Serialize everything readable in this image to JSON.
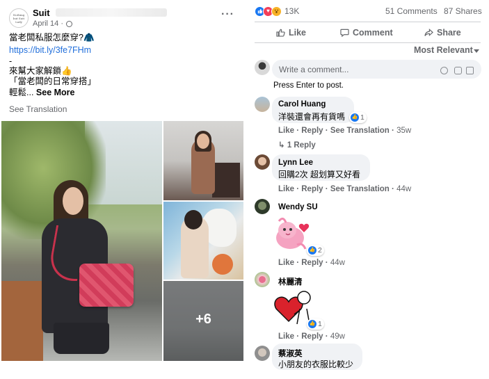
{
  "post": {
    "page_name": "Suit",
    "page_logo_text": "Nothing but Suit Lady",
    "date": "April 14 ·",
    "more": "···",
    "lines": [
      "當老闆私服怎麼穿?🧥",
      "https://bit.ly/3fe7FHm",
      "-",
      "來幫大家解鎖👍",
      "「當老闆的日常穿搭」",
      "輕鬆..."
    ],
    "see_more": "See More",
    "see_translation": "See Translation",
    "extra_photos": "+6"
  },
  "reactions": {
    "icons": [
      "like-icon",
      "love-icon",
      "wow-icon"
    ],
    "count": "13K",
    "comments": "51 Comments",
    "shares": "87 Shares"
  },
  "actions": {
    "like": "Like",
    "comment": "Comment",
    "share": "Share"
  },
  "sort": {
    "label": "Most Relevant"
  },
  "composer": {
    "placeholder": "Write a comment...",
    "hint": "Press Enter to post."
  },
  "comments": [
    {
      "name": "Carol Huang",
      "text": "洋裝還會再有貨嗎",
      "like": "Like",
      "reply": "Reply",
      "translate": "See Translation",
      "time": "35w",
      "reactions": "1",
      "replies": "1 Reply"
    },
    {
      "name": "Lynn Lee",
      "text": "回購2次 超划算又好看",
      "like": "Like",
      "reply": "Reply",
      "translate": "See Translation",
      "time": "44w"
    },
    {
      "name": "Wendy SU",
      "text": "",
      "like": "Like",
      "reply": "Reply",
      "time": "44w",
      "reactions": "2"
    },
    {
      "name": "林麗清",
      "text": "",
      "like": "Like",
      "reply": "Reply",
      "time": "49w",
      "reactions": "1"
    },
    {
      "name": "蔡淑英",
      "text": "小朋友的衣服比較少"
    }
  ],
  "colors": {
    "accent": "#1877f2",
    "link": "#216fdb",
    "muted": "#65676b",
    "bubble": "#f0f2f5"
  }
}
